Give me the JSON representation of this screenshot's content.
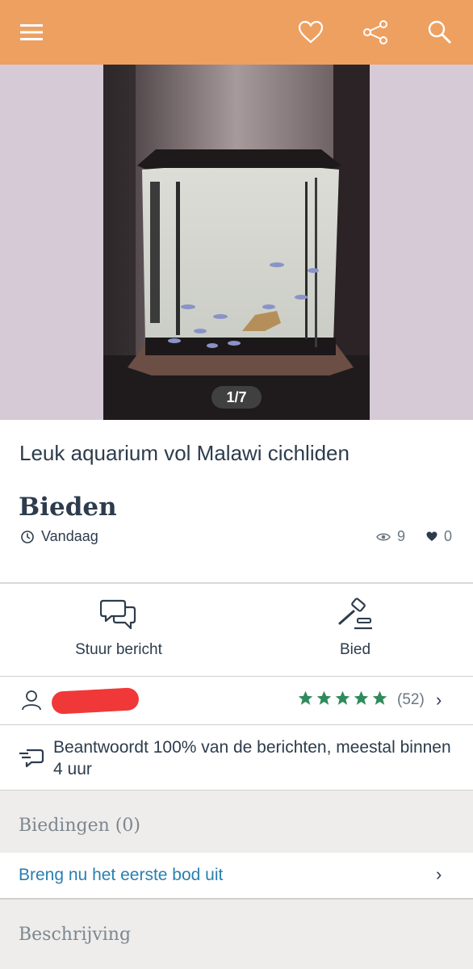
{
  "header": {
    "menu_icon": "menu-icon",
    "favorite_icon": "heart-icon",
    "share_icon": "share-icon",
    "search_icon": "search-icon",
    "background": "#eea060"
  },
  "gallery": {
    "counter": "1/7"
  },
  "listing": {
    "title": "Leuk aquarium vol Malawi cichliden",
    "price": "Bieden",
    "date": "Vandaag",
    "views": "9",
    "favorites": "0"
  },
  "actions": {
    "message_label": "Stuur bericht",
    "bid_label": "Bied"
  },
  "seller": {
    "rating_stars": 5,
    "review_count": "(52)"
  },
  "response_info": "Beantwoordt 100% van de berichten, meestal binnen 4 uur",
  "bids": {
    "header": "Biedingen (0)",
    "cta": "Breng nu het eerste bod uit"
  },
  "description": {
    "header": "Beschrijving"
  },
  "colors": {
    "accent": "#eea060",
    "link": "#2a7fb0",
    "star": "#2f8a5c"
  }
}
